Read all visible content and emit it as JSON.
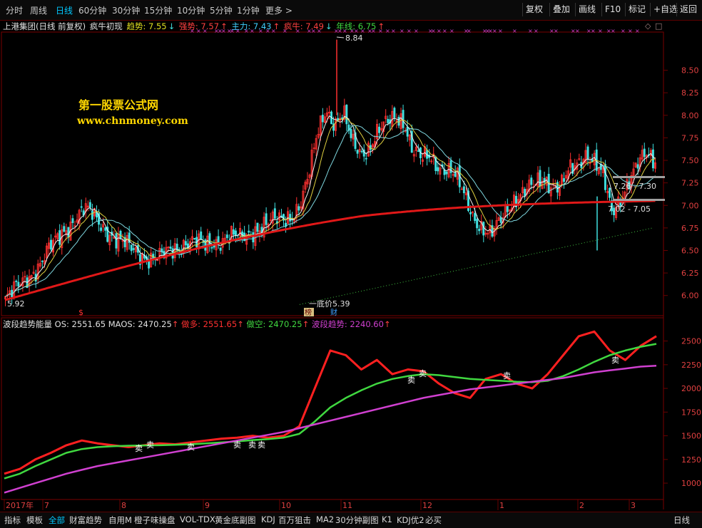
{
  "periods": [
    "分时",
    "周线",
    "日线",
    "60分钟",
    "30分钟",
    "15分钟",
    "10分钟",
    "5分钟",
    "1分钟",
    "更多 >"
  ],
  "active_period": "日线",
  "right_buttons": [
    "复权",
    "叠加",
    "画线",
    "F10",
    "标记",
    "+自选",
    "返回"
  ],
  "info": {
    "stock": "上港集团(日线 前复权)",
    "formula": "疯牛初现",
    "trend": "趋势: 7.55",
    "trend_arrow": "↓",
    "strong": "强势: 7.57",
    "strong_arrow": "↑",
    "main": "主力: 7.43",
    "main_arrow": "↑",
    "bull": "疯牛: 7.49",
    "bull_arrow": "↓",
    "year": "年线: 6.75",
    "year_arrow": "↑"
  },
  "watermark": {
    "line1": "第一股票公式网",
    "line2": "www.chnmoney.com"
  },
  "annotations": {
    "high": "8.84",
    "low": "5.92",
    "bottom_price": "一底价5.39",
    "tag_bang": "榜",
    "tag_cai": "财",
    "range1": "7.26 - 7.30",
    "range2": "7.02 - 7.05",
    "dollar": "$"
  },
  "sub_info": {
    "name": "波段趋势能量",
    "os": "OS: 2551.65",
    "maos": "MAOS: 2470.25",
    "maos_arrow": "↑",
    "long": "做多: 2551.65",
    "long_arrow": "↑",
    "short": "做空: 2470.25",
    "short_arrow": "↑",
    "wave": "波段趋势: 2240.60",
    "wave_arrow": "↑",
    "sell_label": "卖"
  },
  "bottom_tabs": [
    "指标",
    "模板",
    "全部",
    "财富趋势",
    "自用M",
    "橙子味操盘",
    "VOL-TDX",
    "黄金底副图",
    "KDJ",
    "百万狙击",
    "MA2",
    "30分钟副图",
    "K1",
    "KDJ优2",
    "必买"
  ],
  "active_tab": "全部",
  "bottom_right": "日线",
  "colors": {
    "up": "#ff3030",
    "down": "#40e0e0",
    "ma_red": "#e01818",
    "ma_cyan": "#7fd8e0",
    "ma_white": "#f0f0f0",
    "ma_yellow": "#e0d040",
    "os_red": "#ff2020",
    "maos_green": "#40d840",
    "wave_magenta": "#d040d0",
    "grid": "#6a0000"
  },
  "chart_data": [
    {
      "type": "candlestick",
      "title": "上港集团(日线 前复权)",
      "x_ticks": [
        "2017年",
        "7",
        "8",
        "9",
        "10",
        "11",
        "12",
        "1",
        "2",
        "3"
      ],
      "ylim": [
        5.8,
        8.9
      ],
      "y_ticks": [
        6.0,
        6.25,
        6.5,
        6.75,
        7.0,
        7.25,
        7.5,
        7.75,
        8.0,
        8.25,
        8.5
      ],
      "close_path": [
        5.95,
        6.05,
        6.15,
        6.25,
        6.35,
        6.5,
        6.62,
        6.75,
        6.85,
        6.95,
        6.9,
        6.8,
        6.7,
        6.6,
        6.55,
        6.5,
        6.45,
        6.4,
        6.42,
        6.5,
        6.55,
        6.6,
        6.58,
        6.55,
        6.6,
        6.62,
        6.65,
        6.62,
        6.68,
        6.75,
        6.78,
        6.82,
        6.85,
        6.9,
        7.0,
        7.3,
        7.8,
        8.1,
        7.9,
        8.0,
        7.7,
        7.6,
        7.65,
        7.8,
        7.9,
        8.0,
        7.95,
        7.6,
        7.5,
        7.55,
        7.45,
        7.4,
        7.3,
        7.1,
        6.9,
        6.75,
        6.65,
        6.8,
        7.0,
        7.1,
        7.15,
        7.2,
        7.3,
        7.25,
        7.2,
        7.35,
        7.45,
        7.6,
        7.5,
        7.3,
        6.9,
        7.1,
        7.3,
        7.45,
        7.55,
        7.5
      ],
      "series": [
        {
          "name": "年线",
          "final": 6.75
        },
        {
          "name": "趋势",
          "final": 7.55
        },
        {
          "name": "主力",
          "final": 7.43
        },
        {
          "name": "疯牛",
          "final": 7.49
        }
      ],
      "high": 8.84,
      "low": 5.92
    },
    {
      "type": "line",
      "title": "波段趋势能量",
      "ylim": [
        850,
        2700
      ],
      "y_ticks": [
        1000,
        1250,
        1500,
        1750,
        2000,
        2250,
        2500
      ],
      "series": [
        {
          "name": "OS",
          "final": 2551.65,
          "values": [
            1100,
            1150,
            1250,
            1320,
            1400,
            1450,
            1420,
            1400,
            1380,
            1400,
            1420,
            1410,
            1430,
            1450,
            1470,
            1480,
            1500,
            1480,
            1500,
            1600,
            2000,
            2400,
            2350,
            2200,
            2300,
            2150,
            2200,
            2180,
            2050,
            1950,
            1900,
            2100,
            2150,
            2050,
            2000,
            2150,
            2350,
            2550,
            2600,
            2400,
            2300,
            2450,
            2551
          ]
        },
        {
          "name": "MAOS",
          "final": 2470.25,
          "values": [
            1050,
            1100,
            1180,
            1250,
            1320,
            1360,
            1380,
            1390,
            1395,
            1398,
            1400,
            1405,
            1410,
            1420,
            1430,
            1440,
            1455,
            1465,
            1480,
            1520,
            1650,
            1800,
            1900,
            1980,
            2050,
            2100,
            2130,
            2150,
            2140,
            2120,
            2100,
            2090,
            2080,
            2070,
            2065,
            2080,
            2130,
            2200,
            2280,
            2350,
            2400,
            2440,
            2470
          ]
        },
        {
          "name": "波段趋势",
          "final": 2240.6,
          "values": [
            900,
            950,
            1000,
            1050,
            1100,
            1140,
            1180,
            1210,
            1240,
            1270,
            1300,
            1330,
            1360,
            1390,
            1420,
            1450,
            1480,
            1510,
            1540,
            1580,
            1620,
            1660,
            1700,
            1740,
            1780,
            1820,
            1860,
            1900,
            1930,
            1960,
            1990,
            2010,
            2030,
            2050,
            2070,
            2090,
            2110,
            2140,
            2170,
            2190,
            2210,
            2230,
            2240
          ]
        }
      ]
    }
  ]
}
